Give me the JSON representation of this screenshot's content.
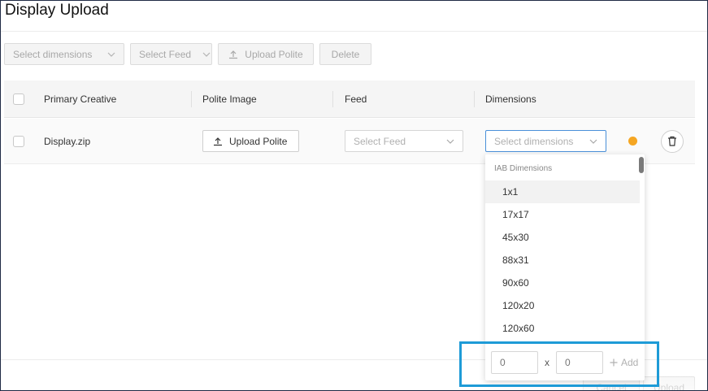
{
  "page": {
    "title": "Display Upload"
  },
  "toolbar": {
    "select_dimensions": "Select dimensions",
    "select_feed": "Select Feed",
    "upload_polite": "Upload Polite",
    "delete": "Delete"
  },
  "table": {
    "headers": [
      "Primary Creative",
      "Polite Image",
      "Feed",
      "Dimensions"
    ],
    "rows": [
      {
        "creative": "Display.zip",
        "polite_button": "Upload Polite",
        "feed_placeholder": "Select Feed",
        "dimensions_placeholder": "Select dimensions"
      }
    ]
  },
  "dropdown": {
    "group_label": "IAB Dimensions",
    "items": [
      "1x1",
      "17x17",
      "45x30",
      "88x31",
      "90x60",
      "120x20",
      "120x60"
    ],
    "width_placeholder": "0",
    "height_placeholder": "0",
    "separator": "x",
    "add_label": "Add"
  },
  "footer": {
    "cancel": "Cancel",
    "upload": "Upload"
  },
  "colors": {
    "accent": "#4a90d9",
    "warning": "#f5a623",
    "highlight": "#1e9bd7"
  },
  "icons": [
    "chevron-down-icon",
    "upload-icon",
    "warning-icon",
    "trash-icon",
    "plus-icon"
  ]
}
